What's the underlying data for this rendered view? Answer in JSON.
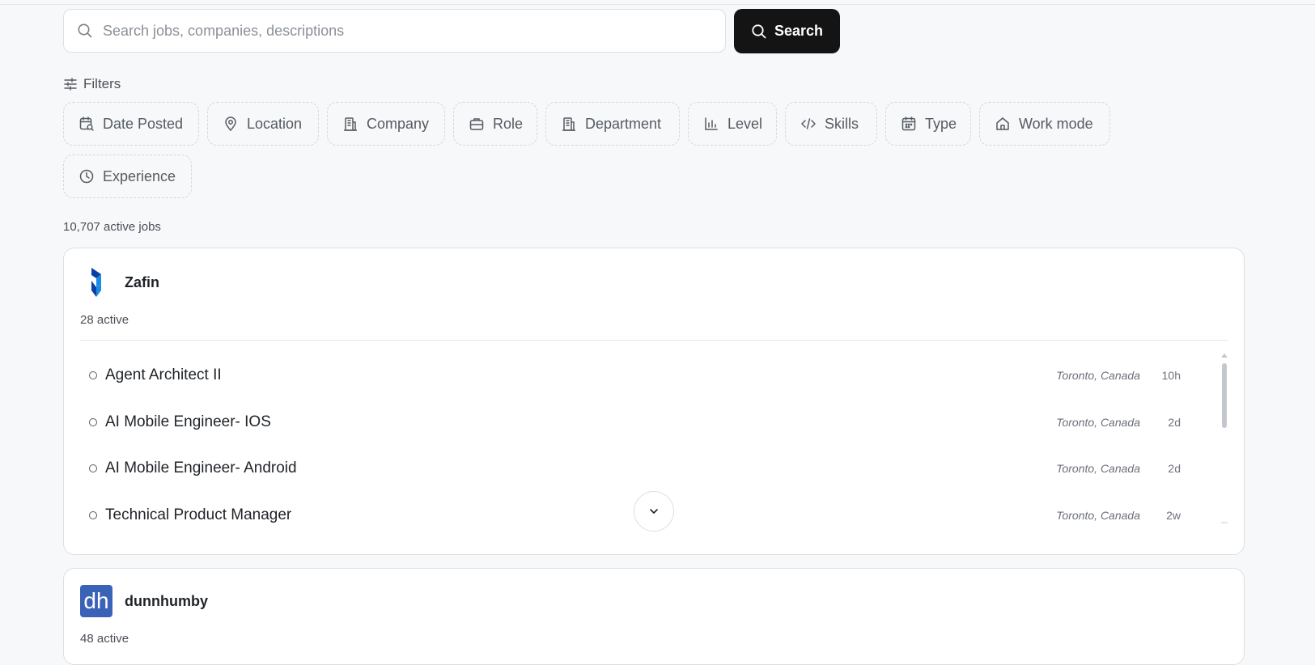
{
  "search": {
    "placeholder": "Search jobs, companies, descriptions",
    "value": "",
    "button_label": "Search"
  },
  "filters": {
    "label": "Filters",
    "chips": [
      {
        "label": "Date Posted",
        "icon": "calendar-search-icon"
      },
      {
        "label": "Location",
        "icon": "map-pin-icon"
      },
      {
        "label": "Company",
        "icon": "building-icon"
      },
      {
        "label": "Role",
        "icon": "briefcase-icon"
      },
      {
        "label": "Department",
        "icon": "building-icon"
      },
      {
        "label": "Level",
        "icon": "bar-chart-icon"
      },
      {
        "label": "Skills",
        "icon": "code-icon"
      },
      {
        "label": "Type",
        "icon": "calendar-icon"
      },
      {
        "label": "Work mode",
        "icon": "home-icon"
      },
      {
        "label": "Experience",
        "icon": "clock-icon"
      }
    ]
  },
  "results": {
    "count_text": "10,707 active jobs"
  },
  "companies": [
    {
      "name": "Zafin",
      "active_text": "28 active",
      "logo_colors": [
        "#0a3fa8",
        "#1e8be0"
      ],
      "jobs": [
        {
          "title": "Agent Architect II",
          "location": "Toronto, Canada",
          "age": "10h"
        },
        {
          "title": "AI Mobile Engineer- IOS",
          "location": "Toronto, Canada",
          "age": "2d"
        },
        {
          "title": "AI Mobile Engineer- Android",
          "location": "Toronto, Canada",
          "age": "2d"
        },
        {
          "title": "Technical Product Manager",
          "location": "Toronto, Canada",
          "age": "2w"
        }
      ]
    },
    {
      "name": "dunnhumby",
      "active_text": "48 active",
      "logo_text": "dh",
      "logo_color": "#3a63b8"
    }
  ],
  "colors": {
    "background": "#f7f8f9",
    "primary_button": "#141414",
    "border": "#dcdfe3"
  }
}
